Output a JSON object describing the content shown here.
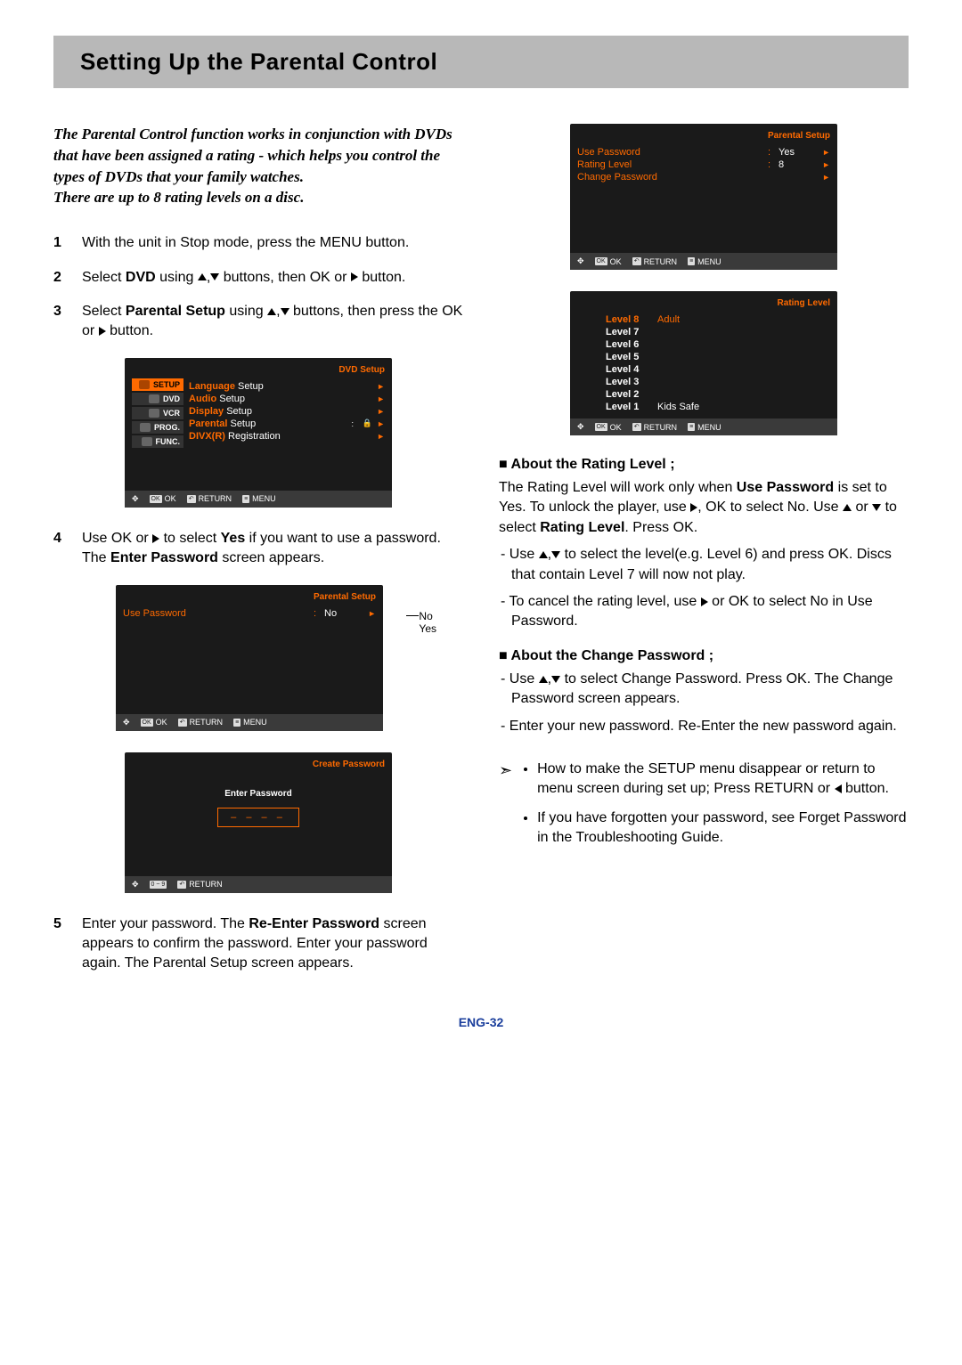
{
  "page_title": "Setting Up the Parental Control",
  "intro_lines": [
    "The Parental Control function works in conjunction with DVDs that have been assigned a rating - which helps you control the types of DVDs that your family watches.",
    "There are up to 8 rating levels on a disc."
  ],
  "steps": {
    "s1": "With the unit in Stop mode, press the MENU button.",
    "s2_a": "Select ",
    "s2_bold": "DVD",
    "s2_b": " using ",
    "s2_c": " buttons, then OK or ",
    "s2_d": " button.",
    "s3_a": "Select ",
    "s3_bold": "Parental Setup",
    "s3_b": " using ",
    "s3_c": " buttons, then press the OK or ",
    "s3_d": " button.",
    "s4_a": "Use OK or ",
    "s4_b": " to select ",
    "s4_bold": "Yes",
    "s4_c": " if you want to use a password. The ",
    "s4_bold2": "Enter Password",
    "s4_d": " screen appears.",
    "s5_a": "Enter your password. The ",
    "s5_bold": "Re-Enter Password",
    "s5_b": " screen appears to confirm the password. Enter your password again. The Parental Setup screen appears."
  },
  "osd_dvd_setup": {
    "title": "DVD Setup",
    "tabs": [
      "SETUP",
      "DVD",
      "VCR",
      "PROG.",
      "FUNC."
    ],
    "rows": [
      {
        "label_hl": "Language",
        "label_rest": " Setup",
        "arrow": "►"
      },
      {
        "label_hl": "Audio",
        "label_rest": " Setup",
        "arrow": "►"
      },
      {
        "label_hl": "Display",
        "label_rest": " Setup",
        "arrow": "►"
      },
      {
        "label_hl": "Parental",
        "label_rest": " Setup",
        "sub": ":",
        "icon": true,
        "arrow": "►"
      },
      {
        "label_hl": "DIVX(R)",
        "label_rest": " Registration",
        "arrow": "►"
      }
    ],
    "footer": [
      "OK",
      "RETURN",
      "MENU"
    ]
  },
  "osd_parental_no": {
    "title": "Parental Setup",
    "row_label": "Use Password",
    "row_sep": ":",
    "row_value": "No",
    "callout": [
      "No",
      "Yes"
    ],
    "footer": [
      "OK",
      "RETURN",
      "MENU"
    ]
  },
  "osd_create_pw": {
    "title": "Create Password",
    "label": "Enter Password",
    "mask": "– – – –",
    "footer": [
      "0 ~ 9",
      "RETURN"
    ]
  },
  "osd_parental_yes": {
    "title": "Parental Setup",
    "rows": [
      {
        "label": "Use Password",
        "sep": ":",
        "val": "Yes",
        "arrow": "►"
      },
      {
        "label": "Rating Level",
        "sep": ":",
        "val": "8",
        "arrow": "►"
      },
      {
        "label": "Change Password",
        "sep": "",
        "val": "",
        "arrow": "►"
      }
    ],
    "footer": [
      "OK",
      "RETURN",
      "MENU"
    ]
  },
  "osd_rating": {
    "title": "Rating Level",
    "rows": [
      {
        "n": "8",
        "suffix": "Adult",
        "active": true
      },
      {
        "n": "7",
        "suffix": "",
        "active": false
      },
      {
        "n": "6",
        "suffix": "",
        "active": false
      },
      {
        "n": "5",
        "suffix": "",
        "active": false
      },
      {
        "n": "4",
        "suffix": "",
        "active": false
      },
      {
        "n": "3",
        "suffix": "",
        "active": false
      },
      {
        "n": "2",
        "suffix": "",
        "active": false
      },
      {
        "n": "1",
        "suffix": "Kids Safe",
        "active": false
      }
    ],
    "footer": [
      "OK",
      "RETURN",
      "MENU"
    ]
  },
  "about_rating": {
    "head": "About the Rating Level ;",
    "p_a": "The Rating Level will work only when ",
    "p_bold": "Use Password",
    "p_b": " is set to Yes. To unlock the player, use ",
    "p_c": ", OK to select No. Use ",
    "p_d": " or ",
    "p_e": " to select ",
    "p_bold2": "Rating Level",
    "p_f": ". Press OK.",
    "d1_a": "- Use ",
    "d1_b": " to select the level(e.g. Level 6) and press OK. Discs that contain Level 7 will now not play.",
    "d2_a": "- To cancel the rating level, use ",
    "d2_b": " or OK to select No in Use Password."
  },
  "about_change_pw": {
    "head": "About the Change Password ;",
    "d1_a": "- Use ",
    "d1_b": " to select Change Password. Press OK. The Change Password screen appears.",
    "d2": "- Enter your new password. Re-Enter the new password again."
  },
  "notes": {
    "n1_a": "How to make the SETUP menu disappear or return to menu screen during set up; Press RETURN or ",
    "n1_b": " button.",
    "n2": "If you have forgotten your password, see Forget Password in the Troubleshooting Guide."
  },
  "page_number": "ENG-32"
}
